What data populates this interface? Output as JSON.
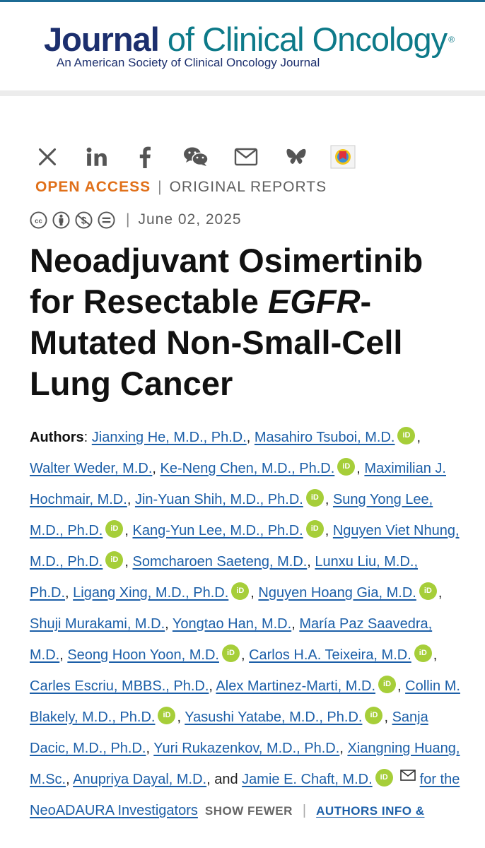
{
  "header": {
    "logo_word1": "Journal",
    "logo_rest": " of Clinical Oncology",
    "logo_reg": "®",
    "subtitle": "An American Society of Clinical Oncology Journal"
  },
  "share_icons": [
    "x-icon",
    "linkedin-icon",
    "facebook-icon",
    "wechat-icon",
    "email-icon",
    "bluesky-icon",
    "mendeley-icon"
  ],
  "article": {
    "open_access": "OPEN ACCESS",
    "separator": "|",
    "report_type": "ORIGINAL REPORTS",
    "license_icons": [
      "cc-icon",
      "attribution-icon",
      "noncommercial-icon",
      "noderivatives-icon"
    ],
    "date": "June 02, 2025",
    "title_part1": "Neoadjuvant Osimertinib for Resectable ",
    "title_italic": "EGFR",
    "title_part2": "-Mutated Non-Small-Cell Lung Cancer"
  },
  "authors": {
    "label": "Authors",
    "list": [
      {
        "name": "Jianxing He, M.D., Ph.D.",
        "orcid": false
      },
      {
        "name": "Masahiro Tsuboi, M.D.",
        "orcid": true
      },
      {
        "name": "Walter Weder, M.D.",
        "orcid": false
      },
      {
        "name": "Ke-Neng Chen, M.D., Ph.D.",
        "orcid": true
      },
      {
        "name": "Maximilian J. Hochmair, M.D.",
        "orcid": false
      },
      {
        "name": "Jin-Yuan Shih, M.D., Ph.D.",
        "orcid": true
      },
      {
        "name": "Sung Yong Lee, M.D., Ph.D.",
        "orcid": true
      },
      {
        "name": "Kang-Yun Lee, M.D., Ph.D.",
        "orcid": true
      },
      {
        "name": "Nguyen Viet Nhung, M.D., Ph.D.",
        "orcid": true
      },
      {
        "name": "Somcharoen Saeteng, M.D.",
        "orcid": false
      },
      {
        "name": "Lunxu Liu, M.D., Ph.D.",
        "orcid": false
      },
      {
        "name": "Ligang Xing, M.D., Ph.D.",
        "orcid": true
      },
      {
        "name": "Nguyen Hoang Gia, M.D.",
        "orcid": true
      },
      {
        "name": "Shuji Murakami, M.D.",
        "orcid": false
      },
      {
        "name": "Yongtao Han, M.D.",
        "orcid": false
      },
      {
        "name": "María Paz Saavedra, M.D.",
        "orcid": false
      },
      {
        "name": "Seong Hoon Yoon, M.D.",
        "orcid": true
      },
      {
        "name": "Carlos H.A. Teixeira, M.D.",
        "orcid": true
      },
      {
        "name": "Carles Escriu, MBBS., Ph.D.",
        "orcid": false
      },
      {
        "name": "Alex Martinez-Marti, M.D.",
        "orcid": true
      },
      {
        "name": "Collin M. Blakely, M.D., Ph.D.",
        "orcid": true
      },
      {
        "name": "Yasushi Yatabe, M.D., Ph.D.",
        "orcid": true
      },
      {
        "name": "Sanja Dacic, M.D., Ph.D.",
        "orcid": false
      },
      {
        "name": "Yuri Rukazenkov, M.D., Ph.D.",
        "orcid": false
      },
      {
        "name": "Xiangning Huang, M.Sc.",
        "orcid": false
      },
      {
        "name": "Anupriya Dayal, M.D.",
        "orcid": false
      }
    ],
    "conjunction": ", and ",
    "last_author": "Jamie E. Chaft, M.D.",
    "group": "for the NeoADAURA Investigators",
    "orcid_text": "iD",
    "show_fewer": "SHOW FEWER",
    "authors_info": "AUTHORS INFO &"
  },
  "colors": {
    "brand_navy": "#1c2f6e",
    "brand_teal": "#0d7a89",
    "open_access": "#e0701a",
    "link": "#1c5fa8",
    "orcid": "#a6ce39"
  }
}
